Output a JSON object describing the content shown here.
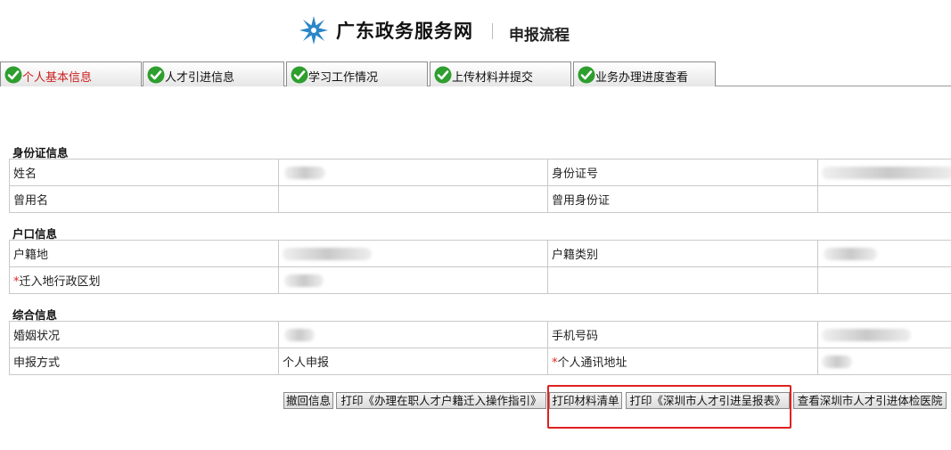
{
  "header": {
    "brand": "广东政务服务网",
    "page_title": "申报流程"
  },
  "tabs": [
    {
      "label": "个人基本信息",
      "active": true
    },
    {
      "label": "人才引进信息",
      "active": false
    },
    {
      "label": "学习工作情况",
      "active": false
    },
    {
      "label": "上传材料并提交",
      "active": false
    },
    {
      "label": "业务办理进度查看",
      "active": false
    }
  ],
  "sections": {
    "id_info": {
      "title": "身份证信息",
      "rows": [
        {
          "label1": "姓名",
          "label2": "身份证号"
        },
        {
          "label1": "曾用名",
          "label2": "曾用身份证"
        }
      ]
    },
    "household": {
      "title": "户口信息",
      "rows": [
        {
          "label1": "户籍地",
          "label2": "户籍类别"
        },
        {
          "label1": "迁入地行政区划",
          "required_mark": "*"
        }
      ]
    },
    "general": {
      "title": "综合信息",
      "rows": [
        {
          "label1": "婚姻状况",
          "label2": "手机号码"
        },
        {
          "label1": "申报方式",
          "value1": "个人申报",
          "label2": "个人通讯地址",
          "required_mark": "*"
        }
      ]
    }
  },
  "actions": {
    "withdraw": "撤回信息",
    "print_guide": "打印《办理在职人才户籍迁入操作指引》",
    "print_list": "打印材料清单",
    "print_form": "打印《深圳市人才引进呈报表》",
    "view_hospital": "查看深圳市人才引进体检医院"
  },
  "colors": {
    "active_tab": "#cc1f1f",
    "required": "#dd2222",
    "highlight": "#e02020",
    "check": "#2e9e2e"
  }
}
